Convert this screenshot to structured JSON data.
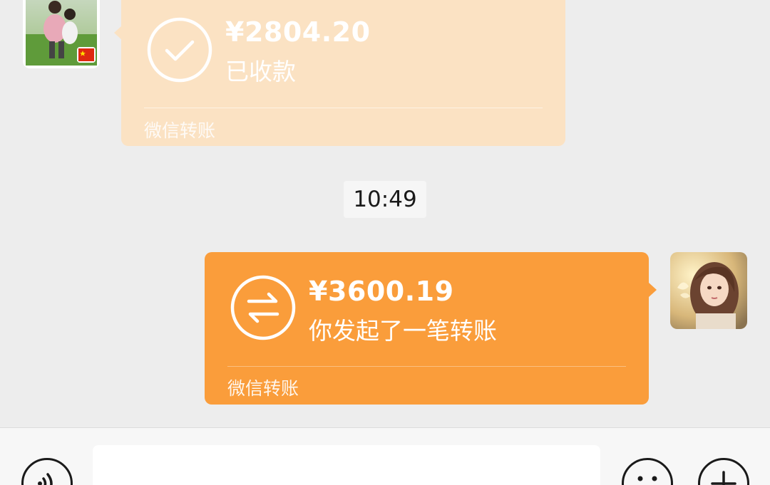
{
  "messages": {
    "received_transfer": {
      "amount": "¥2804.20",
      "status": "已收款",
      "footer": "微信转账",
      "icon": "checkmark-circle-icon"
    },
    "timestamp": "10:49",
    "sent_transfer": {
      "amount": "¥3600.19",
      "status": "你发起了一笔转账",
      "footer": "微信转账",
      "icon": "transfer-arrows-icon"
    }
  },
  "input_bar": {
    "voice_icon": "voice-icon",
    "emoji_icon": "emoji-icon",
    "plus_icon": "plus-icon",
    "text_value": ""
  },
  "colors": {
    "received_card": "#fbe2c3",
    "sent_card": "#fa9d3b",
    "background": "#ededed"
  }
}
